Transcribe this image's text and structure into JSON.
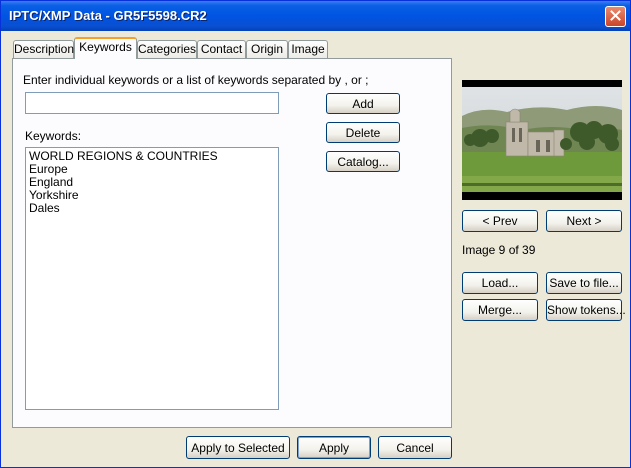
{
  "window": {
    "title": "IPTC/XMP Data - GR5F5598.CR2"
  },
  "tabs": [
    {
      "label": "Description"
    },
    {
      "label": "Keywords"
    },
    {
      "label": "Categories"
    },
    {
      "label": "Contact"
    },
    {
      "label": "Origin"
    },
    {
      "label": "Image"
    }
  ],
  "active_tab": "Keywords",
  "keywords_panel": {
    "instruction": "Enter individual keywords or a list of keywords separated by , or ;",
    "keyword_input_value": "",
    "add_label": "Add",
    "delete_label": "Delete",
    "catalog_label": "Catalog...",
    "list_label": "Keywords:",
    "keywords": [
      "WORLD REGIONS & COUNTRIES",
      "Europe",
      "England",
      "Yorkshire",
      "Dales"
    ]
  },
  "preview": {
    "prev_label": "< Prev",
    "next_label": "Next >",
    "counter": "Image 9 of 39",
    "load_label": "Load...",
    "save_label": "Save to file...",
    "merge_label": "Merge...",
    "tokens_label": "Show tokens..."
  },
  "footer": {
    "apply_selected_label": "Apply to Selected",
    "apply_label": "Apply",
    "cancel_label": "Cancel"
  },
  "colors": {
    "titlebar": "#0054e3",
    "dialog_face": "#ece9d8",
    "tab_highlight": "#f3a12b",
    "close_button": "#c9452b"
  },
  "icons": {
    "close": "close-icon"
  }
}
